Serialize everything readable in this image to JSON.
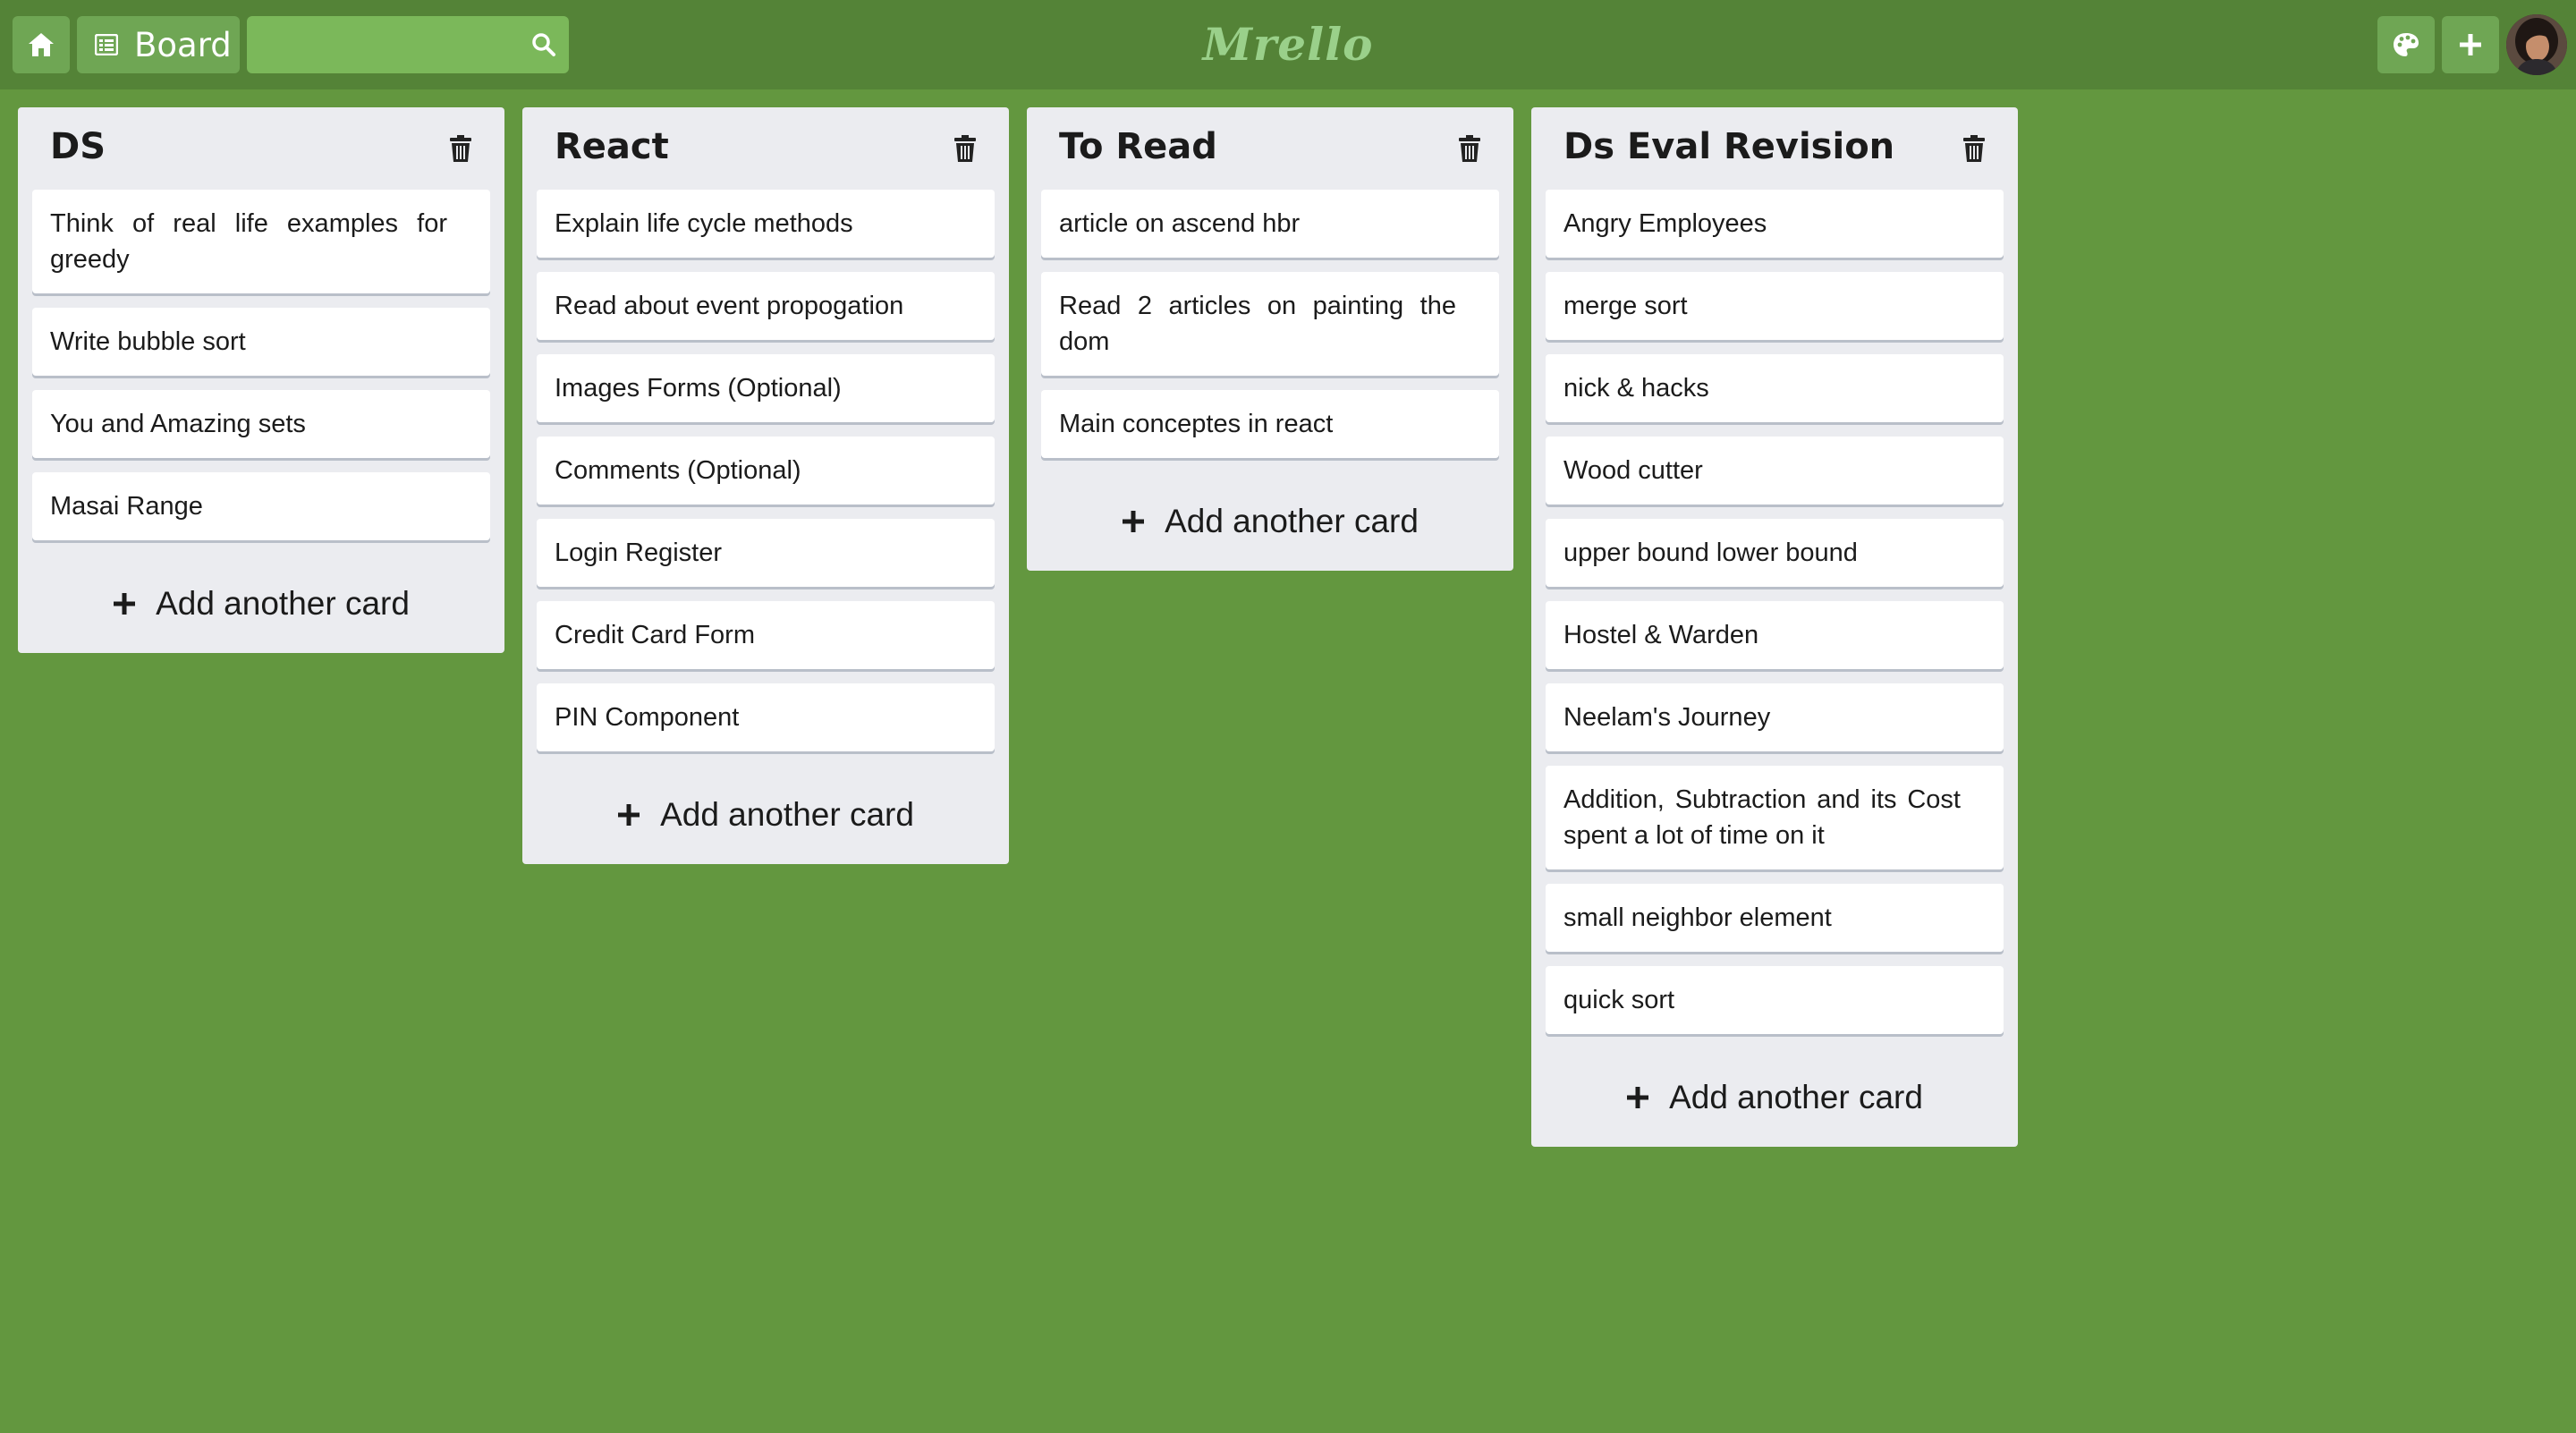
{
  "topbar": {
    "board_label": "Board",
    "search_value": "",
    "search_placeholder": "",
    "app_title": "Mrello",
    "bar_color": "#548337",
    "button_color": "#6fa654"
  },
  "board": {
    "background_color": "#63973f",
    "list_color": "#ebecf0",
    "lists": [
      {
        "title": "DS",
        "cards": [
          "Think of real life examples for greedy",
          "Write bubble sort",
          "You and Amazing sets",
          "Masai Range"
        ],
        "add_label": "Add another card"
      },
      {
        "title": "React",
        "cards": [
          "Explain life cycle methods",
          "Read about event propogation",
          "Images Forms (Optional)",
          "Comments (Optional)",
          "Login Register",
          "Credit Card Form",
          "PIN Component"
        ],
        "add_label": "Add another card"
      },
      {
        "title": "To Read",
        "cards": [
          "article on ascend hbr",
          "Read 2 articles on painting the dom",
          "Main conceptes in react"
        ],
        "add_label": "Add another card"
      },
      {
        "title": "Ds Eval Revision",
        "cards": [
          "Angry Employees",
          "merge sort",
          "nick & hacks",
          "Wood cutter",
          "upper bound lower bound",
          "Hostel & Warden",
          "Neelam's Journey",
          "Addition, Subtraction and its Cost spent a lot of time on it",
          "small neighbor element",
          "quick sort"
        ],
        "add_label": "Add another card"
      }
    ]
  },
  "icons": {
    "home": "home-icon",
    "board": "board-icon",
    "search": "search-icon",
    "palette": "palette-icon",
    "add": "plus-icon",
    "trash": "trash-icon"
  }
}
